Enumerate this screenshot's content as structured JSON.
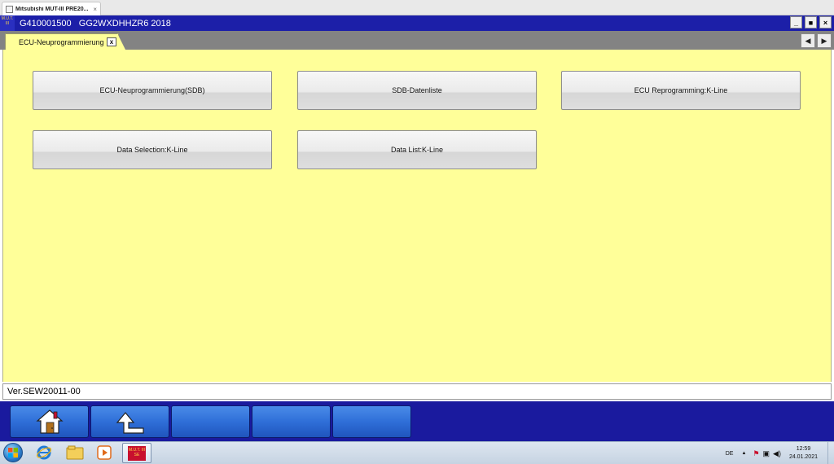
{
  "browser_tab": {
    "title": "Mitsubishi MUT-III PRE20...",
    "close": "×"
  },
  "titlebar": {
    "logo": "M.U.T. III",
    "title": "G410001500   GG2WXDHHZR6 2018",
    "minimize": "_",
    "maximize": "■",
    "close": "×"
  },
  "tabbar": {
    "active_tab": "ECU-Neuprogrammierung",
    "close": "x",
    "nav_left": "◀",
    "nav_right": "▶"
  },
  "main": {
    "buttons": [
      {
        "label": "ECU-Neuprogrammierung(SDB)"
      },
      {
        "label": "SDB-Datenliste"
      },
      {
        "label": "ECU Reprogramming:K-Line"
      },
      {
        "label": "Data Selection:K-Line"
      },
      {
        "label": "Data List:K-Line"
      }
    ]
  },
  "version": "Ver.SEW20011-00",
  "function_bar": {
    "keys": [
      {
        "icon": "home-icon"
      },
      {
        "icon": "back-icon"
      },
      {
        "icon": ""
      },
      {
        "icon": ""
      },
      {
        "icon": ""
      }
    ]
  },
  "taskbar": {
    "mut_logo": "M.U.T. III SE",
    "language": "DE",
    "time": "12:59",
    "date": "24.01.2021"
  }
}
